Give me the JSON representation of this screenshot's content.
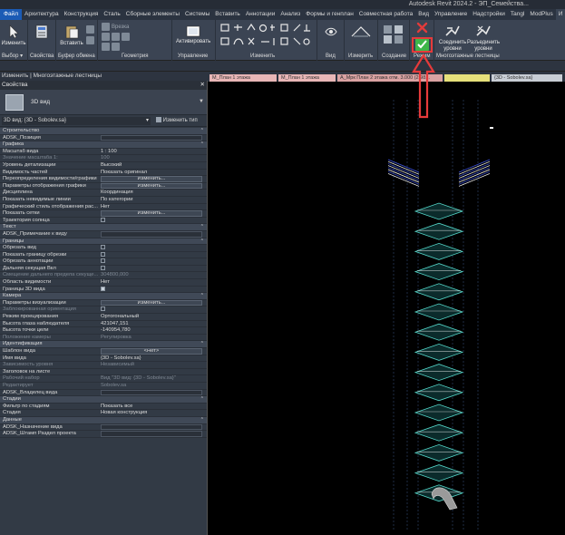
{
  "app": {
    "title": "Autodesk Revit 2024.2 - ЭП_Семейства..."
  },
  "ribbon_tabs": [
    "Файл",
    "Архитектура",
    "Конструкция",
    "Сталь",
    "Сборные элементы",
    "Системы",
    "Вставить",
    "Аннотации",
    "Анализ",
    "Формы и генплан",
    "Совместная работа",
    "Вид",
    "Управление",
    "Надстройки",
    "Tangl",
    "ModPlus",
    "И"
  ],
  "ribbon": {
    "modify_label": "Изменить",
    "select_label": "Выбор ▾",
    "properties_label": "Свойства",
    "paste_label": "Вставить",
    "clipboard_label": "Буфер обмена",
    "cut_label": "Врезка",
    "geometry_label": "Геометрия",
    "activate_label": "Активировать",
    "manage_label": "Управление",
    "modify_group_label": "Изменить",
    "view_label": "Вид",
    "measure_label": "Измерить",
    "create_label": "Создание",
    "mode_label": "Режим",
    "join_levels_label": "Соединить уровни",
    "unjoin_levels_label": "Разъединить уровни",
    "multistorey_label": "Многоэтажные лестницы"
  },
  "context_bar": "Изменить | Многоэтажные лестницы",
  "properties": {
    "title": "Свойства",
    "type_name": "3D вид",
    "instance": "3D вид: {3D - Sobolev.sa}",
    "edit_type": "Изменить тип",
    "rows": [
      {
        "kind": "cat",
        "name": "Строительство"
      },
      {
        "kind": "prop",
        "name": "ADSK_Позиция",
        "value": "",
        "field": true
      },
      {
        "kind": "cat",
        "name": "Графика"
      },
      {
        "kind": "prop",
        "name": "Масштаб вида",
        "value": "1 : 100"
      },
      {
        "kind": "prop",
        "name": "Значение масштаба  1:",
        "value": "100",
        "dim": true
      },
      {
        "kind": "prop",
        "name": "Уровень детализации",
        "value": "Высокий"
      },
      {
        "kind": "prop",
        "name": "Видимость частей",
        "value": "Показать оригинал"
      },
      {
        "kind": "prop",
        "name": "Переопределения видимости/графики",
        "value": "Изменить...",
        "btn": true
      },
      {
        "kind": "prop",
        "name": "Параметры отображения графики",
        "value": "Изменить...",
        "btn": true
      },
      {
        "kind": "prop",
        "name": "Дисциплина",
        "value": "Координация"
      },
      {
        "kind": "prop",
        "name": "Показать невидимые линии",
        "value": "По категории"
      },
      {
        "kind": "prop",
        "name": "Графический стиль отображения рас...",
        "value": "Нет"
      },
      {
        "kind": "prop",
        "name": "Показать сетки",
        "value": "Изменить...",
        "btn": true
      },
      {
        "kind": "prop",
        "name": "Траектория солнца",
        "value": "",
        "check": "off"
      },
      {
        "kind": "cat",
        "name": "Текст"
      },
      {
        "kind": "prop",
        "name": "ADSK_Примечание к виду",
        "value": "",
        "field": true
      },
      {
        "kind": "cat",
        "name": "Границы"
      },
      {
        "kind": "prop",
        "name": "Обрезать вид",
        "value": "",
        "check": "off"
      },
      {
        "kind": "prop",
        "name": "Показать границу обрезки",
        "value": "",
        "check": "off"
      },
      {
        "kind": "prop",
        "name": "Обрезать аннотации",
        "value": "",
        "check": "off"
      },
      {
        "kind": "prop",
        "name": "Дальняя секущая Вкл",
        "value": "",
        "check": "off"
      },
      {
        "kind": "prop",
        "name": "Смещение дальнего предела секуще...",
        "value": "304800,000",
        "dim": true
      },
      {
        "kind": "prop",
        "name": "Область видимости",
        "value": "Нет"
      },
      {
        "kind": "prop",
        "name": "Границы 3D вида",
        "value": "",
        "check": "on"
      },
      {
        "kind": "cat",
        "name": "Камера"
      },
      {
        "kind": "prop",
        "name": "Параметры визуализации",
        "value": "Изменить...",
        "btn": true
      },
      {
        "kind": "prop",
        "name": "Заблокированная ориентация",
        "value": "",
        "check": "off",
        "dim": true
      },
      {
        "kind": "prop",
        "name": "Режим проецирования",
        "value": "Ортогональный"
      },
      {
        "kind": "prop",
        "name": "Высота глаза наблюдателя",
        "value": "421047,151"
      },
      {
        "kind": "prop",
        "name": "Высота точки цели",
        "value": "-140954,780"
      },
      {
        "kind": "prop",
        "name": "Положение камеры",
        "value": "Регулировка",
        "dim": true
      },
      {
        "kind": "cat",
        "name": "Идентификация"
      },
      {
        "kind": "prop",
        "name": "Шаблон вида",
        "value": "<Нет>",
        "btn": true
      },
      {
        "kind": "prop",
        "name": "Имя вида",
        "value": "{3D - Sobolev.sa}"
      },
      {
        "kind": "prop",
        "name": "Зависимость уровня",
        "value": "Независимый",
        "dim": true
      },
      {
        "kind": "prop",
        "name": "Заголовок на листе",
        "value": ""
      },
      {
        "kind": "prop",
        "name": "Рабочий набор",
        "value": "Вид \"3D вид: {3D - Sobolev.sa}\"",
        "dim": true
      },
      {
        "kind": "prop",
        "name": "Редактирует",
        "value": "Sobolev.sa",
        "dim": true
      },
      {
        "kind": "prop",
        "name": "ADSK_Владелец вида",
        "value": "",
        "field": true
      },
      {
        "kind": "cat",
        "name": "Стадии"
      },
      {
        "kind": "prop",
        "name": "Фильтр по стадиям",
        "value": "Показать все"
      },
      {
        "kind": "prop",
        "name": "Стадия",
        "value": "Новая конструкция"
      },
      {
        "kind": "cat",
        "name": "Данные"
      },
      {
        "kind": "prop",
        "name": "ADSK_Назначение вида",
        "value": "",
        "field": true
      },
      {
        "kind": "prop",
        "name": "ADSK_Штамп Раздел проекта",
        "value": "",
        "field": true
      }
    ]
  },
  "view_tabs": [
    {
      "label": "М_План 1 этажа",
      "color": "#e8b6b6"
    },
    {
      "label": "М_План 1 этажа",
      "color": "#e8b6b6"
    },
    {
      "label": "А_Мрк План 2 этажа отм. 3.000 (2.98...",
      "color": "#d9a2a2"
    },
    {
      "label": "",
      "color": "#e6e07a"
    },
    {
      "label": "{3D - Sobolev.sa}",
      "color": "#c8cdd4"
    }
  ],
  "colors": {
    "accent_red": "#e63a3a",
    "finish_green": "#3fb64a",
    "stair_cyan": "#54d6c8",
    "railing_blue": "#3d54e6"
  }
}
